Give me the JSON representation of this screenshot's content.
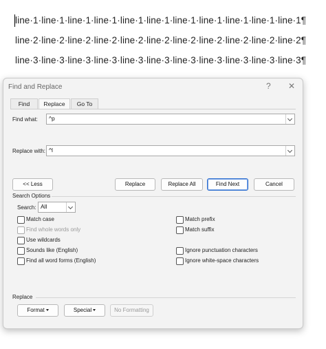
{
  "document": {
    "lines": [
      "line·1·line·1·line·1·line·1·line·1·line·1·line·1·line·1·line·1·line·1·line·1¶",
      "line·2·line·2·line·2·line·2·line·2·line·2·line·2·line·2·line·2·line·2·line·2¶",
      "line·3·line·3·line·3·line·3·line·3·line·3·line·3·line·3·line·3·line·3·line·3¶"
    ]
  },
  "dialog": {
    "title": "Find and Replace",
    "help_glyph": "?",
    "close_glyph": "✕",
    "tabs": [
      {
        "label": "Find",
        "active": false
      },
      {
        "label": "Replace",
        "active": true
      },
      {
        "label": "Go To",
        "active": false
      }
    ],
    "find_what": {
      "label": "Find what:",
      "value": "^p"
    },
    "replace_with": {
      "label": "Replace with:",
      "value": "^l"
    },
    "buttons": {
      "less": "<< Less",
      "replace": "Replace",
      "replace_all": "Replace All",
      "find_next": "Find Next",
      "cancel": "Cancel"
    },
    "search_options": {
      "heading": "Search Options",
      "search_label": "Search:",
      "search_value": "All",
      "left_options": [
        {
          "label": "Match case",
          "checked": false,
          "enabled": true
        },
        {
          "label": "Find whole words only",
          "checked": false,
          "enabled": false
        },
        {
          "label": "Use wildcards",
          "checked": false,
          "enabled": true
        },
        {
          "label": "Sounds like (English)",
          "checked": false,
          "enabled": true
        },
        {
          "label": "Find all word forms (English)",
          "checked": false,
          "enabled": true
        }
      ],
      "right_options": [
        {
          "label": "Match prefix",
          "checked": false,
          "enabled": true
        },
        {
          "label": "Match suffix",
          "checked": false,
          "enabled": true
        },
        {
          "label": "Ignore punctuation characters",
          "checked": false,
          "enabled": true
        },
        {
          "label": "Ignore white-space characters",
          "checked": false,
          "enabled": true
        }
      ]
    },
    "replace_section": {
      "heading": "Replace",
      "format": "Format",
      "special": "Special",
      "no_formatting": "No Formatting"
    }
  }
}
